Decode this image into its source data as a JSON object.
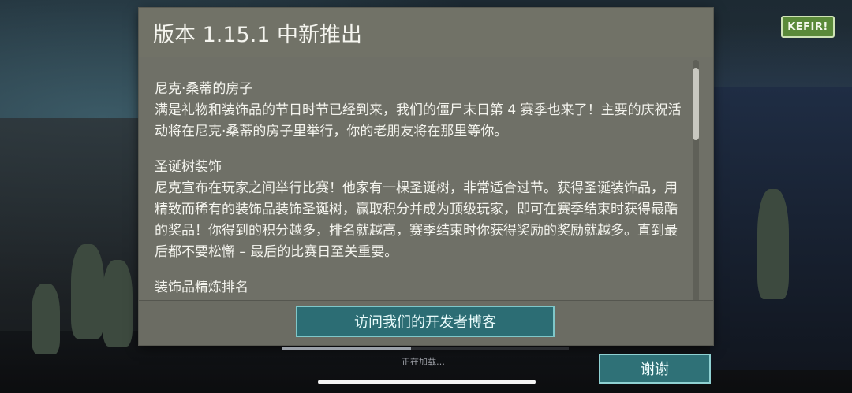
{
  "brand": {
    "label": "KEFIR!"
  },
  "dialog": {
    "title": "版本 1.15.1 中新推出",
    "sections": [
      {
        "title": "尼克·桑蒂的房子",
        "body": "满是礼物和装饰品的节日时节已经到来，我们的僵尸末日第 4 赛季也来了！主要的庆祝活动将在尼克·桑蒂的房子里举行，你的老朋友将在那里等你。"
      },
      {
        "title": "圣诞树装饰",
        "body": "尼克宣布在玩家之间举行比赛！他家有一棵圣诞树，非常适合过节。获得圣诞装饰品，用精致而稀有的装饰品装饰圣诞树，赢取积分并成为顶级玩家，即可在赛季结束时获得最酷的奖品！你得到的积分越多，排名就越高，赛季结束时你获得奖励的奖励就越多。直到最后都不要松懈 – 最后的比赛日至关重要。"
      },
      {
        "title": "装饰品精炼排名",
        "body": ""
      }
    ],
    "blog_button": "访问我们的开发者博客"
  },
  "loading": {
    "text": "正在加载…",
    "progress": 0.45
  },
  "thanks_button": "谢谢",
  "colors": {
    "dialog_bg": "#6f7067",
    "button_bg": "#2c6d74",
    "button_border": "#7fc7c9"
  }
}
